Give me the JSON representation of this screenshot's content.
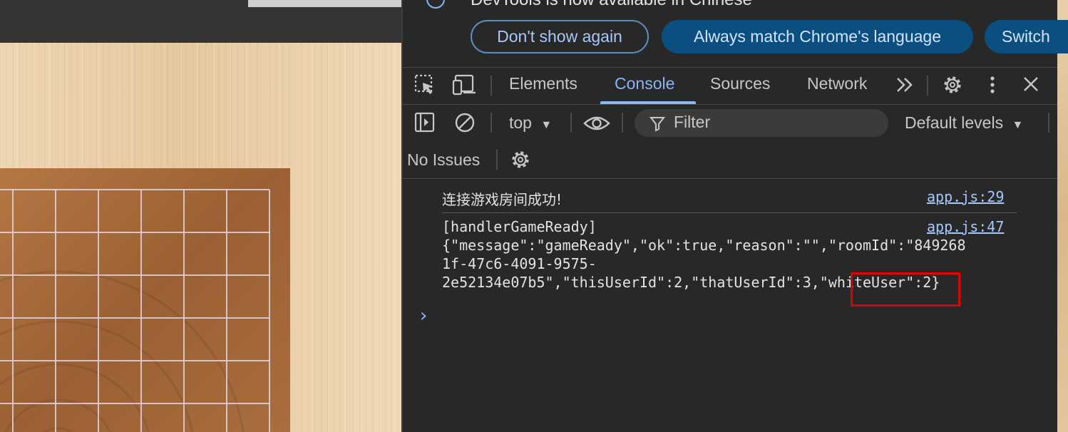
{
  "page": {
    "board_lines": 7
  },
  "devtools": {
    "language_banner": {
      "message": "DevTools is now available in Chinese",
      "dont_show_again": "Don't show again",
      "always_match": "Always match Chrome's language",
      "switch": "Switch"
    },
    "tabs": [
      "Elements",
      "Console",
      "Sources",
      "Network"
    ],
    "active_tab": "Console",
    "console_toolbar": {
      "context": "top",
      "filter_placeholder": "Filter",
      "levels": "Default levels",
      "issues": "No Issues"
    },
    "messages": [
      {
        "text": "连接游戏房间成功!",
        "source": "app.js:29"
      },
      {
        "lines": [
          "[handlerGameReady]",
          "{\"message\":\"gameReady\",\"ok\":true,\"reason\":\"\",\"roomId\":\"849268",
          "1f-47c6-4091-9575-",
          "2e52134e07b5\",\"thisUserId\":2,\"thatUserId\":3,\"whiteUser\":2}"
        ],
        "source": "app.js:47",
        "highlighted_key": "\"whiteUser\""
      }
    ],
    "colors": {
      "accent": "#8ab4f8",
      "highlight": "#e00000",
      "background": "#282828"
    }
  }
}
